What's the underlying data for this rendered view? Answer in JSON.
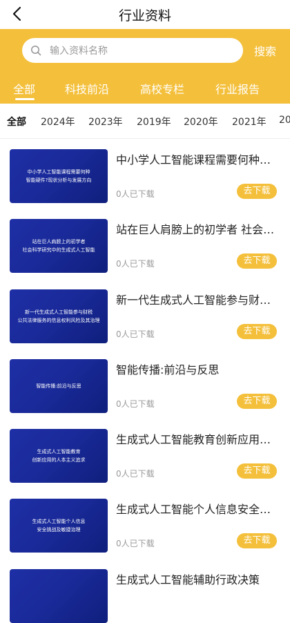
{
  "header": {
    "title": "行业资料",
    "back_icon": "chevron-left-icon"
  },
  "search": {
    "placeholder": "输入资料名称",
    "button_label": "搜索",
    "icon": "search-icon"
  },
  "categories": [
    "全部",
    "科技前沿",
    "高校专栏",
    "行业报告"
  ],
  "years": [
    "全部",
    "2024年",
    "2023年",
    "2019年",
    "2020年",
    "2021年",
    "20"
  ],
  "accent_color": "#f4c03c",
  "items": [
    {
      "title": "中小学人工智能课程需要何种智能硬件?现状分析与发展方向",
      "thumb_lines": [
        "中小学人工智能课程需要何种",
        "智能硬件?现状分析与发展方向"
      ],
      "downloads": "0人已下载",
      "button": "去下载"
    },
    {
      "title": "站在巨人肩膀上的初学者 社会科学研究中的生成式人工智能",
      "thumb_lines": [
        "站在巨人肩膀上的初学者",
        "社会科学研究中的生成式人工智能"
      ],
      "downloads": "0人已下载",
      "button": "去下载"
    },
    {
      "title": "新一代生成式人工智能参与财税公共法律服务的信息权利风险及其治理",
      "thumb_lines": [
        "新一代生成式人工智能参与财税",
        "公共法律服务的信息权利风险及其治理"
      ],
      "downloads": "0人已下载",
      "button": "去下载"
    },
    {
      "title": "智能传播:前沿与反思",
      "thumb_lines": [
        "智能传播:前沿与反思"
      ],
      "downloads": "0人已下载",
      "button": "去下载"
    },
    {
      "title": "生成式人工智能教育创新应用的人本主义追求",
      "thumb_lines": [
        "生成式人工智能教育",
        "创新应用的人本主义追求"
      ],
      "downloads": "0人已下载",
      "button": "去下载"
    },
    {
      "title": "生成式人工智能个人信息安全挑战及敏捷治理",
      "thumb_lines": [
        "生成式人工智能个人信息",
        "安全挑战及敏捷治理"
      ],
      "downloads": "0人已下载",
      "button": "去下载"
    },
    {
      "title": "生成式人工智能辅助行政决策",
      "thumb_lines": [],
      "downloads": "",
      "button": ""
    }
  ]
}
